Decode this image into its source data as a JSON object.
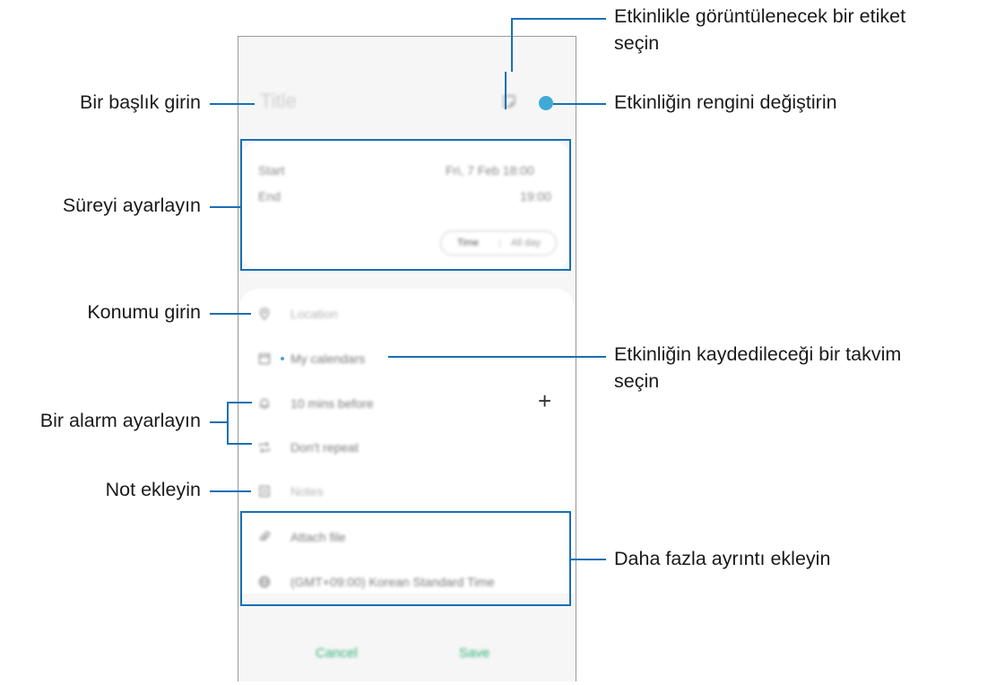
{
  "form": {
    "title_placeholder": "Title",
    "start_label": "Start",
    "start_value": "Fri, 7 Feb  18:00",
    "end_label": "End",
    "end_value": "19:00",
    "toggle_time": "Time",
    "toggle_allday": "All day",
    "location": "Location",
    "calendar": "My calendars",
    "alarm": "10 mins before",
    "repeat": "Don't repeat",
    "notes": "Notes",
    "attach": "Attach file",
    "timezone": "(GMT+09:00) Korean Standard Time",
    "cancel": "Cancel",
    "save": "Save",
    "event_color": "#3fa9d6"
  },
  "callouts": {
    "title": "Bir başlık girin",
    "duration": "Süreyi ayarlayın",
    "location": "Konumu girin",
    "alarm": "Bir alarm ayarlayın",
    "notes": "Not ekleyin",
    "sticker_line1": "Etkinlikle görüntülenecek bir etiket",
    "sticker_line2": "seçin",
    "color": "Etkinliğin rengini değiştirin",
    "calendar_line1": "Etkinliğin kaydedileceği bir takvim",
    "calendar_line2": "seçin",
    "more": "Daha fazla ayrıntı ekleyin"
  }
}
